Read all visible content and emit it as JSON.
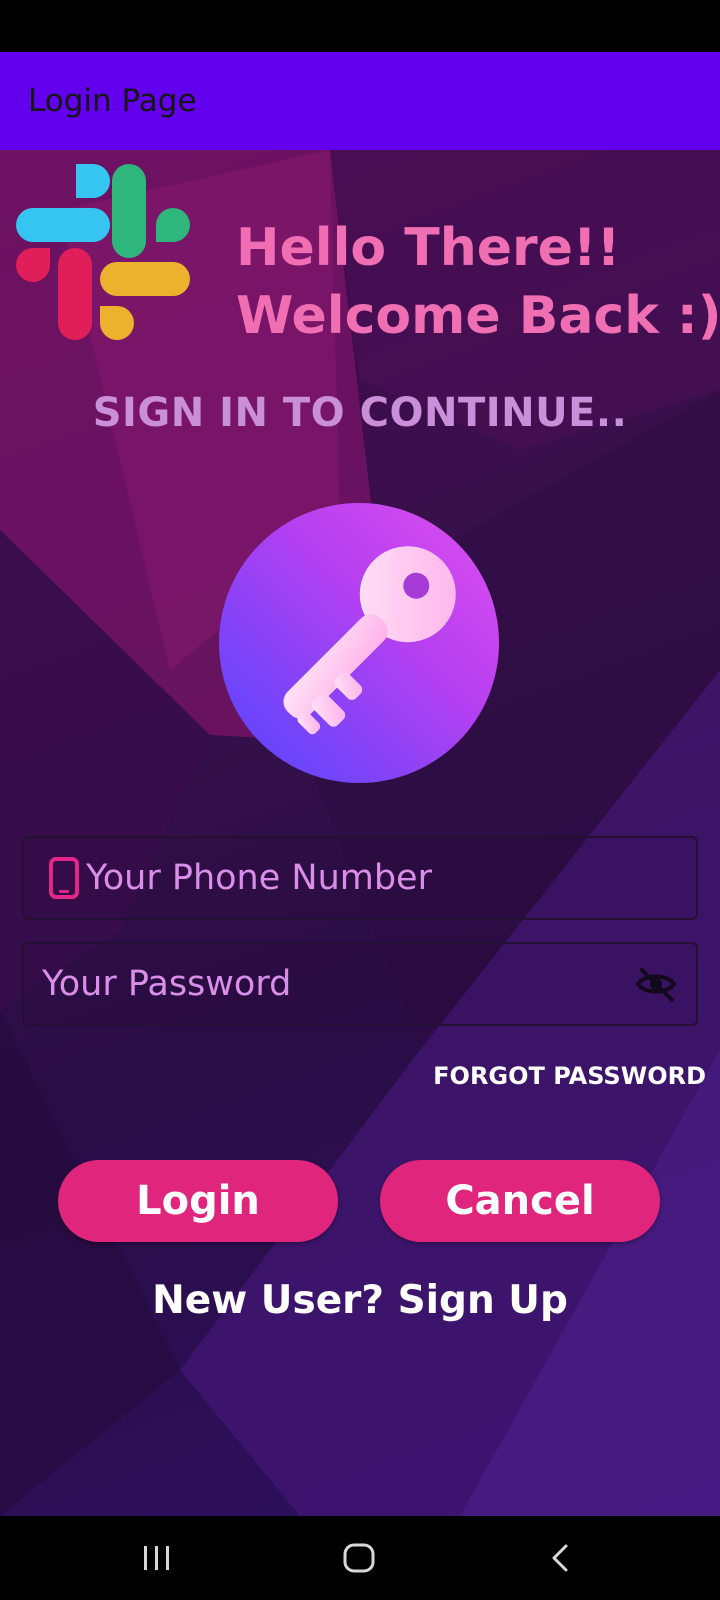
{
  "app_bar": {
    "title": "Login Page"
  },
  "header": {
    "greeting_line1": "Hello There!!",
    "greeting_line2": "Welcome Back :)",
    "subtitle": "SIGN IN TO CONTINUE.."
  },
  "form": {
    "phone_placeholder": "Your Phone Number",
    "password_placeholder": "Your Password",
    "forgot_password": "FORGOT PASSWORD"
  },
  "buttons": {
    "login": "Login",
    "cancel": "Cancel"
  },
  "signup_link": "New User? Sign Up",
  "icons": {
    "logo": "slack-logo-icon",
    "key": "key-icon",
    "phone": "phone-icon",
    "eye": "eye-off-icon",
    "nav_recents": "recents-icon",
    "nav_home": "home-icon",
    "nav_back": "back-icon"
  },
  "colors": {
    "app_bar": "#6200ee",
    "accent_pink": "#e0267c",
    "greeting": "#f06fb3",
    "subtitle": "#c98fd8",
    "field_text": "#d98ee8"
  }
}
